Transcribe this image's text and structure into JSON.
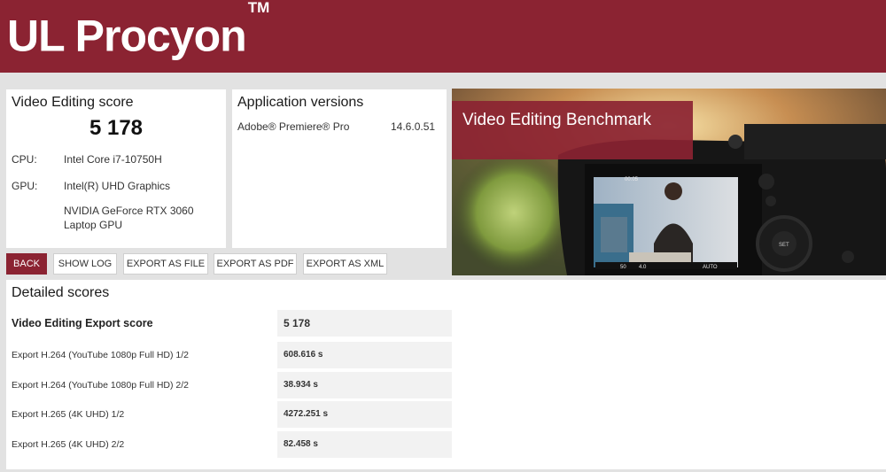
{
  "header": {
    "brand": "UL Procyon",
    "trademark": "TM"
  },
  "score_card": {
    "title": "Video Editing score",
    "score": "5 178",
    "cpu_label": "CPU:",
    "cpu_value": "Intel Core i7-10750H",
    "gpu_label": "GPU:",
    "gpu_value_1": "Intel(R) UHD Graphics",
    "gpu_value_2": "NVIDIA GeForce RTX 3060 Laptop GPU"
  },
  "versions_card": {
    "title": "Application versions",
    "apps": [
      {
        "name": "Adobe® Premiere® Pro",
        "version": "14.6.0.51"
      }
    ]
  },
  "hero": {
    "title": "Video Editing Benchmark",
    "camera_readouts": [
      "00:05",
      "50",
      "4.0",
      "AUTO",
      "SET"
    ]
  },
  "toolbar": {
    "back": "BACK",
    "show_log": "SHOW LOG",
    "export_file": "EXPORT AS FILE",
    "export_pdf": "EXPORT AS PDF",
    "export_xml": "EXPORT AS XML"
  },
  "detailed": {
    "title": "Detailed scores",
    "rows": [
      {
        "label": "Video Editing Export score",
        "value": "5 178"
      },
      {
        "label": "Export H.264 (YouTube 1080p Full HD) 1/2",
        "value": "608.616 s"
      },
      {
        "label": "Export H.264 (YouTube 1080p Full HD) 2/2",
        "value": "38.934 s"
      },
      {
        "label": "Export H.265 (4K UHD) 1/2",
        "value": "4272.251 s"
      },
      {
        "label": "Export H.265 (4K UHD) 2/2",
        "value": "82.458 s"
      }
    ]
  },
  "colors": {
    "brand": "#8b2332",
    "background": "#e2e2e2",
    "row_value_bg": "#f2f2f2"
  }
}
